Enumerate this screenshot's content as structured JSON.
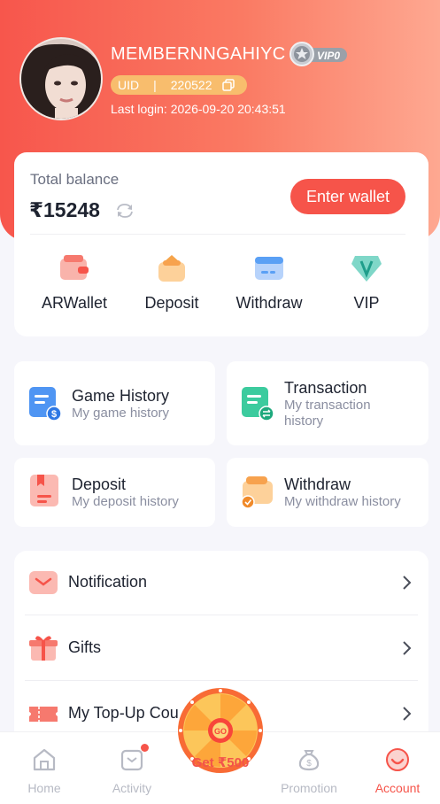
{
  "profile": {
    "username": "MEMBERNNGAHIYC",
    "vip_badge": "VIP0",
    "uid_label": "UID",
    "uid_sep": "|",
    "uid_value": "220522",
    "last_login": "Last login: 2026-09-20 20:43:51"
  },
  "balance": {
    "label": "Total balance",
    "amount": "₹15248",
    "enter_wallet": "Enter wallet"
  },
  "quick_actions": [
    {
      "label": "ARWallet",
      "icon": "wallet-icon"
    },
    {
      "label": "Deposit",
      "icon": "deposit-icon"
    },
    {
      "label": "Withdraw",
      "icon": "card-icon"
    },
    {
      "label": "VIP",
      "icon": "vip-gem-icon"
    }
  ],
  "history": {
    "game": {
      "title": "Game History",
      "sub": "My game history"
    },
    "transaction": {
      "title": "Transaction",
      "sub1": "My transaction",
      "sub2": "history"
    },
    "deposit": {
      "title": "Deposit",
      "sub": "My deposit history"
    },
    "withdraw": {
      "title": "Withdraw",
      "sub": "My withdraw history"
    }
  },
  "menu": [
    {
      "label": "Notification",
      "icon": "mail-icon"
    },
    {
      "label": "Gifts",
      "icon": "gift-icon"
    },
    {
      "label": "My Top-Up Cou",
      "icon": "ticket-icon"
    }
  ],
  "tabbar": {
    "home": "Home",
    "activity": "Activity",
    "get": "Get ₹500",
    "promotion": "Promotion",
    "account": "Account"
  },
  "colors": {
    "accent": "#f6544a",
    "header_start": "#f7564c",
    "header_end": "#fea891",
    "uid_pill": "#f8bd6d"
  }
}
